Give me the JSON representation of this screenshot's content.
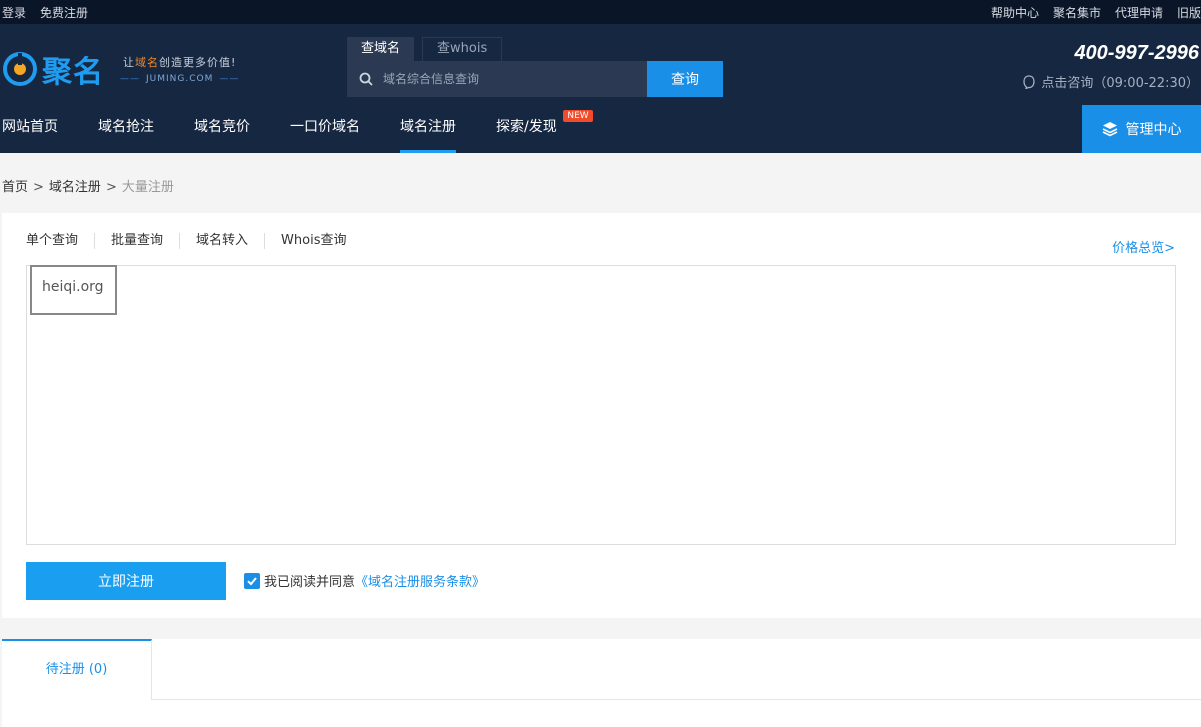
{
  "topbar": {
    "left": [
      "登录",
      "免费注册"
    ],
    "right": [
      "帮助中心",
      "聚名集市",
      "代理申请",
      "旧版"
    ]
  },
  "header": {
    "logo_text": "聚名",
    "slogan_prefix": "让",
    "slogan_highlight": "域名",
    "slogan_suffix": "创造更多价值!",
    "slogan_domain": "JUMING.COM",
    "search_tabs": [
      "查域名",
      "查whois"
    ],
    "search_placeholder": "域名综合信息查询",
    "search_button": "查询",
    "hotline": "400-997-2996",
    "consult": "点击咨询（09:00-22:30）"
  },
  "nav": {
    "items": [
      "网站首页",
      "域名抢注",
      "域名竞价",
      "一口价域名",
      "域名注册",
      "探索/发现"
    ],
    "badge": "NEW",
    "manage": "管理中心"
  },
  "breadcrumb": {
    "home": "首页",
    "level2": "域名注册",
    "current": "大量注册",
    "sep": ">"
  },
  "panel": {
    "tabs": [
      "单个查询",
      "批量查询",
      "域名转入",
      "Whois查询"
    ],
    "price_link": "价格总览>",
    "domain_value": "heiqi.org",
    "register_button": "立即注册",
    "agree_text": "我已阅读并同意",
    "terms_link": "《域名注册服务条款》"
  },
  "bottom": {
    "pending_tab": "待注册 (0)"
  },
  "colors": {
    "header_bg": "#162742",
    "topbar_bg": "#0a1528",
    "accent": "#1a8fe8"
  }
}
